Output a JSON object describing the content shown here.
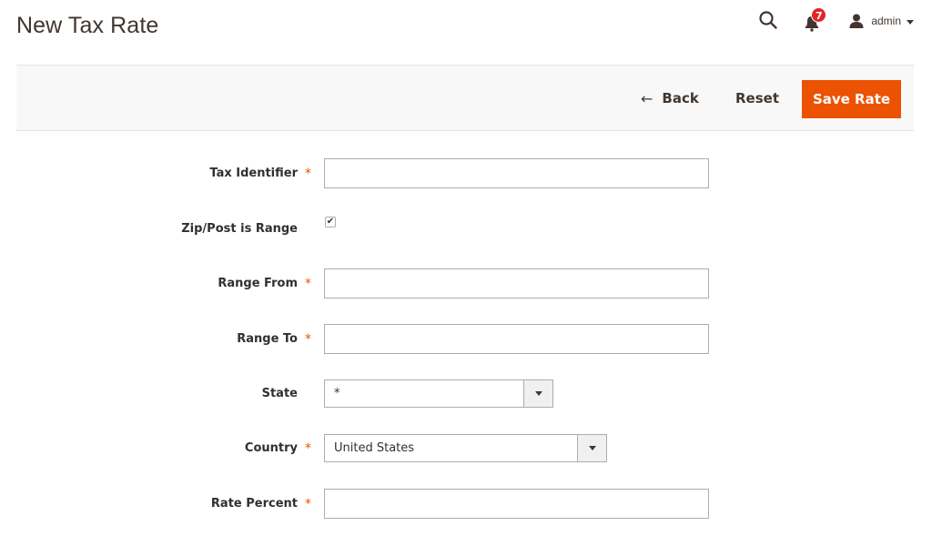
{
  "header": {
    "title": "New Tax Rate",
    "search_icon": "search-icon",
    "notifications": {
      "icon": "bell-icon",
      "count": "7"
    },
    "user": {
      "icon": "user-icon",
      "name": "admin"
    }
  },
  "actions": {
    "back_label": "Back",
    "reset_label": "Reset",
    "save_label": "Save Rate"
  },
  "form": {
    "required_mark": "*",
    "tax_identifier": {
      "label": "Tax Identifier",
      "value": ""
    },
    "zip_is_range": {
      "label": "Zip/Post is Range",
      "checked": true,
      "mark": "✔"
    },
    "range_from": {
      "label": "Range From",
      "value": ""
    },
    "range_to": {
      "label": "Range To",
      "value": ""
    },
    "state": {
      "label": "State",
      "value": "*"
    },
    "country": {
      "label": "Country",
      "value": "United States"
    },
    "rate_percent": {
      "label": "Rate Percent",
      "value": ""
    }
  },
  "colors": {
    "accent": "#eb5202",
    "badge": "#e22626",
    "action_bar_bg": "#f8f8f8"
  }
}
